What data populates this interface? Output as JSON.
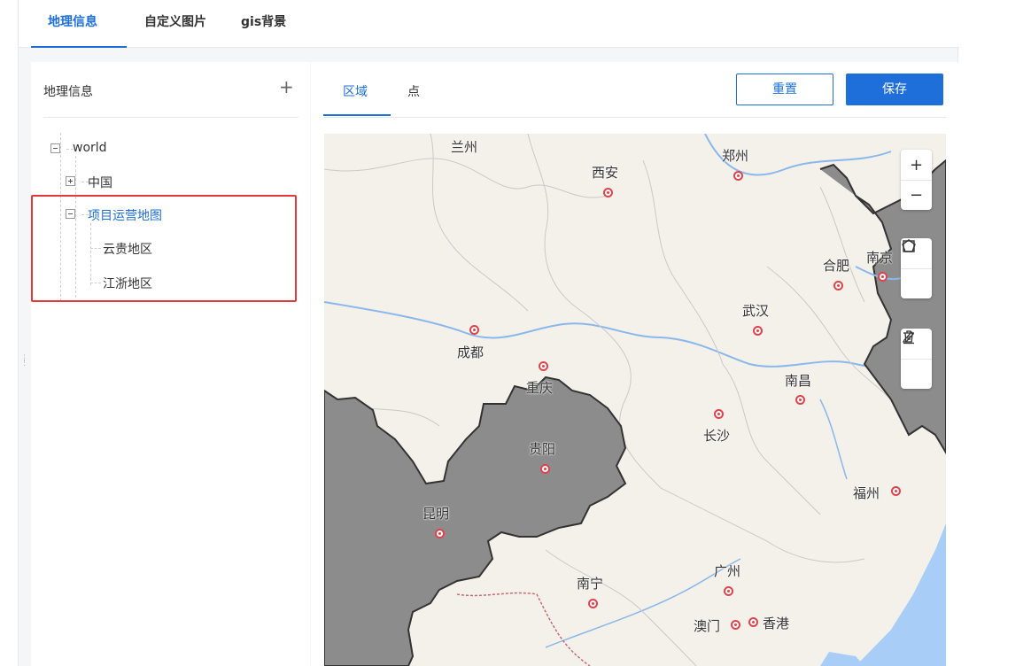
{
  "top_tabs": [
    {
      "label": "地理信息"
    },
    {
      "label": "自定义图片"
    },
    {
      "label": "gis背景"
    }
  ],
  "left_panel": {
    "title": "地理信息",
    "add_icon": "plus-icon",
    "tree": {
      "root": "world",
      "china": "中国",
      "project_map": "项目运营地图",
      "child_1": "云贵地区",
      "child_2": "江浙地区"
    }
  },
  "right_panel": {
    "tabs": [
      {
        "label": "区域"
      },
      {
        "label": "点"
      }
    ],
    "reset_label": "重置",
    "save_label": "保存"
  },
  "map": {
    "controls": [
      "zoom-in-icon",
      "zoom-out-icon",
      "polygon-icon",
      "rectangle-icon",
      "edit-icon",
      "trash-icon"
    ],
    "cities": {
      "lanzhou": "兰州",
      "zhengzhou": "郑州",
      "xian": "西安",
      "hefei": "合肥",
      "nanjing": "南京",
      "wuhan": "武汉",
      "chengdu": "成都",
      "chongqing": "重庆",
      "nanchang": "南昌",
      "changsha": "长沙",
      "guiyang": "贵阳",
      "fuzhou": "福州",
      "kunming": "昆明",
      "guangzhou": "广州",
      "nanning": "南宁",
      "macau": "澳门",
      "hongkong": "香港"
    },
    "colors": {
      "selected_region": "#8c8c8c",
      "water": "#a8cdf7",
      "land": "#f4f1ea",
      "accent": "#1e6fd9",
      "highlight_box": "#e23a3a"
    }
  }
}
